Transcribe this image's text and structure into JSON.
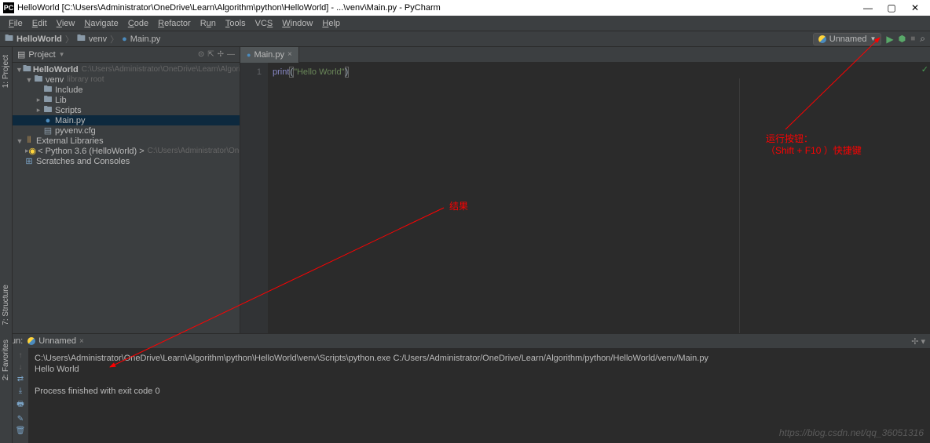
{
  "window": {
    "title": "HelloWorld [C:\\Users\\Administrator\\OneDrive\\Learn\\Algorithm\\python\\HelloWorld] - ...\\venv\\Main.py - PyCharm",
    "min": "—",
    "max": "▢",
    "close": "✕"
  },
  "menu": {
    "file": "File",
    "edit": "Edit",
    "view": "View",
    "navigate": "Navigate",
    "code": "Code",
    "refactor": "Refactor",
    "run": "Run",
    "tools": "Tools",
    "vcs": "VCS",
    "window": "Window",
    "help": "Help"
  },
  "breadcrumb": {
    "project": "HelloWorld",
    "folder": "venv",
    "file": "Main.py"
  },
  "runconfig": {
    "name": "Unnamed",
    "dropdown": "▼"
  },
  "project_panel": {
    "title": "Project",
    "tree": {
      "root": "HelloWorld",
      "root_path": "C:\\Users\\Administrator\\OneDrive\\Learn\\Algorithm\\python\\Hel",
      "venv": "venv",
      "venv_note": "library root",
      "include": "Include",
      "lib": "Lib",
      "scripts": "Scripts",
      "main": "Main.py",
      "pyvenv": "pyvenv.cfg",
      "ext": "External Libraries",
      "python": "< Python 3.6 (HelloWorld) >",
      "python_path": "C:\\Users\\Administrator\\OneDrive\\Learn\\Al",
      "scratches": "Scratches and Consoles"
    }
  },
  "editor": {
    "tab": "Main.py",
    "line1": "1",
    "code": {
      "func": "print",
      "open": "(",
      "str": "\"Hello World\"",
      "close": ")"
    }
  },
  "run_panel": {
    "label": "Run:",
    "config": "Unnamed",
    "console_line1": "C:\\Users\\Administrator\\OneDrive\\Learn\\Algorithm\\python\\HelloWorld\\venv\\Scripts\\python.exe C:/Users/Administrator/OneDrive/Learn/Algorithm/python/HelloWorld/venv/Main.py",
    "console_line2": "Hello World",
    "console_line3": "",
    "console_line4": "Process finished with exit code 0"
  },
  "annotations": {
    "result": "结果",
    "run_button1": "运行按钮：",
    "run_button2": "（Shift + F10 ）快捷键"
  },
  "watermark": "https://blog.csdn.net/qq_36051316",
  "leftrail": {
    "project": "1: Project",
    "structure": "7: Structure"
  },
  "bottomrail": {
    "fav": "2: Favorites"
  }
}
